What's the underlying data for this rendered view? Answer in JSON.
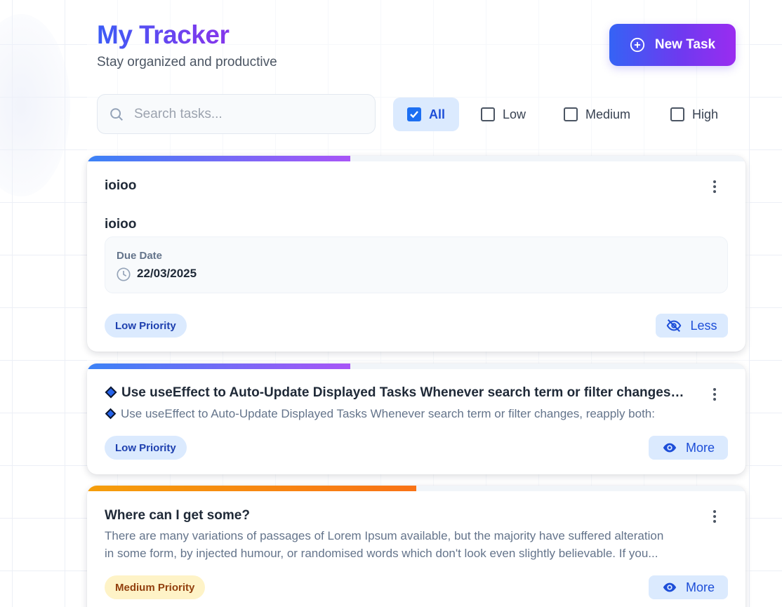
{
  "header": {
    "title": "My Tracker",
    "subtitle": "Stay organized and productive",
    "new_task_label": "New Task"
  },
  "search": {
    "placeholder": "Search tasks..."
  },
  "filters": [
    {
      "label": "All",
      "checked": true
    },
    {
      "label": "Low",
      "checked": false
    },
    {
      "label": "Medium",
      "checked": false
    },
    {
      "label": "High",
      "checked": false
    }
  ],
  "colors": {
    "accent": "#1d4ed8",
    "low_bar_gradient": [
      "#3b82f6",
      "#a855f7"
    ],
    "medium_bar_gradient": [
      "#f59e0b",
      "#f97316"
    ],
    "low_badge_bg": "#dbeafe",
    "medium_badge_bg": "#fef3c7"
  },
  "tasks": [
    {
      "title": "ioioo",
      "description": "ioioo",
      "due_label": "Due Date",
      "due_date": "22/03/2025",
      "priority": "Low Priority",
      "toggle_label": "Less",
      "toggle_icon": "eye-off-icon",
      "progress": 0.4
    },
    {
      "title": "Use useEffect to Auto-Update Displayed Tasks Whenever search term or filter changes, reapply both:",
      "description": "Use useEffect to Auto-Update Displayed Tasks Whenever search term or filter changes, reapply both:",
      "priority": "Low Priority",
      "toggle_label": "More",
      "toggle_icon": "eye-icon",
      "progress": 0.4
    },
    {
      "title": "Where can I get some?",
      "description_line1": "There are many variations of passages of Lorem Ipsum available, but the majority have suffered alteration",
      "description_line2": "in some form, by injected humour, or randomised words which don't look even slightly believable. If you...",
      "priority": "Medium Priority",
      "toggle_label": "More",
      "toggle_icon": "eye-icon",
      "progress": 0.5
    }
  ]
}
